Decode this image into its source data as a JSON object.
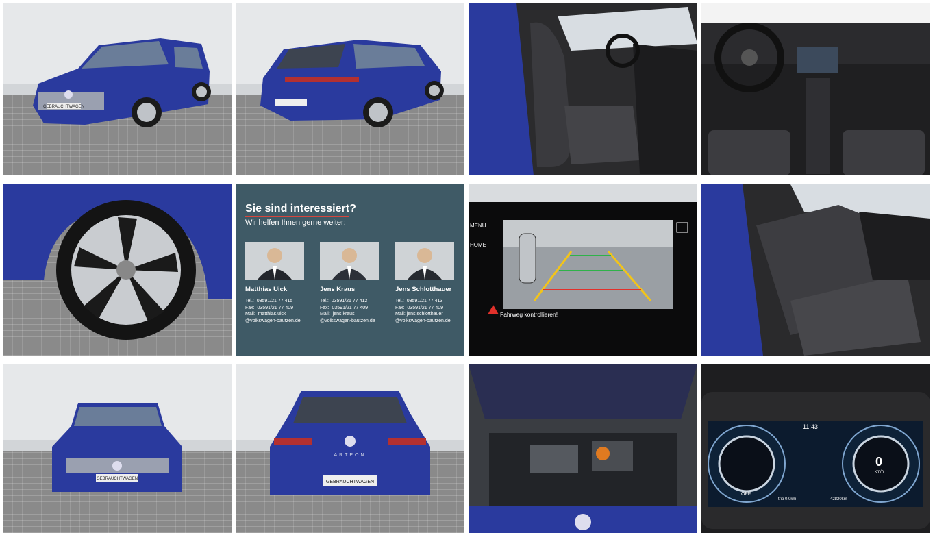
{
  "gallery": {
    "tiles": [
      {
        "name": "front-three-quarter-photo"
      },
      {
        "name": "rear-three-quarter-photo"
      },
      {
        "name": "front-seats-photo"
      },
      {
        "name": "cockpit-photo"
      },
      {
        "name": "wheel-photo"
      },
      {
        "name": "contact-card"
      },
      {
        "name": "rear-camera-photo"
      },
      {
        "name": "rear-seats-photo"
      },
      {
        "name": "front-view-photo"
      },
      {
        "name": "rear-view-photo"
      },
      {
        "name": "engine-bay-photo"
      },
      {
        "name": "instrument-cluster-photo"
      }
    ]
  },
  "photo_text": {
    "plate": "GEBRAUCHTWAGEN",
    "badge": "ARTEON",
    "camera_warning": "Fahrweg kontrollieren!",
    "camera_menu_1": "MENU",
    "camera_menu_2": "HOME",
    "cluster_time": "11:43",
    "cluster_speed": "0",
    "cluster_unit": "km/h",
    "cluster_off": "OFF",
    "cluster_trip": "trip 0.0km",
    "cluster_odo": "42820km"
  },
  "contact": {
    "title": "Sie sind interessiert?",
    "subtitle": "Wir helfen Ihnen gerne weiter:",
    "persons": [
      {
        "name": "Matthias Uick",
        "info": "Tel.:  03591/21 77 415\nFax:  03591/21 77 409\nMail:  matthias.uick\n@volkswagen-bautzen.de"
      },
      {
        "name": "Jens Kraus",
        "info": "Tel.:  03591/21 77 412\nFax:  03591/21 77 409\nMail:  jens.kraus\n@volkswagen-bautzen.de"
      },
      {
        "name": "Jens Schlotthauer",
        "info": "Tel.:  03591/21 77 413\nFax:  03591/21 77 409\nMail: jens.schlotthauer\n@volkswagen-bautzen.de"
      }
    ]
  },
  "colors": {
    "car_blue": "#2a3a9e",
    "card_bg": "#3f5a66",
    "accent_red": "#d6463e"
  }
}
